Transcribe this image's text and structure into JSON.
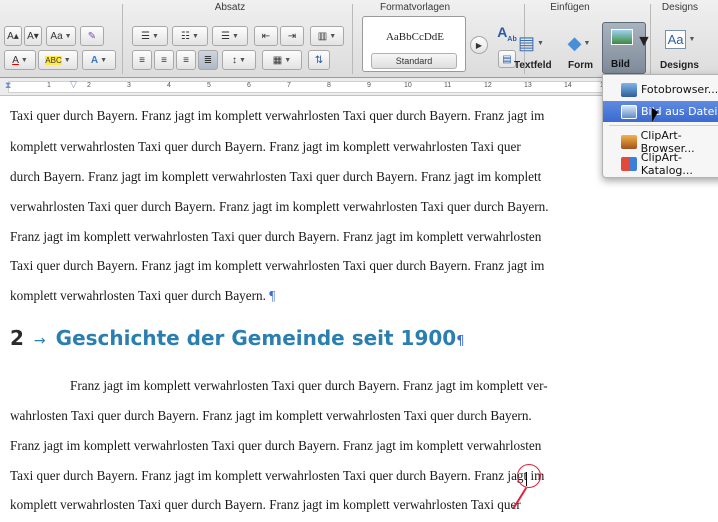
{
  "ribbon": {
    "groups": {
      "absatz": "Absatz",
      "formatvorlagen": "Formatvorlagen",
      "einfuegen": "Einfügen",
      "designs": "Designs"
    },
    "font_buttons": {
      "grow": "A▴",
      "shrink": "A▾",
      "case": "Aa",
      "color_a": "A",
      "highlight": "ABC",
      "effect": "A"
    },
    "style_sample": "AaBbCcDdE",
    "style_name": "Standard",
    "insert": {
      "textfeld": "Textfeld",
      "form": "Form",
      "bild": "Bild"
    },
    "designs_button": "Designs",
    "designs_sample": "Aa"
  },
  "ruler": {
    "ticks": [
      "1",
      "2",
      "3",
      "4",
      "5",
      "6",
      "7",
      "8",
      "9",
      "10",
      "11",
      "12",
      "13",
      "14",
      "15"
    ]
  },
  "menu": {
    "items": [
      {
        "label": "Fotobrowser..."
      },
      {
        "label": "Bild aus Datei..."
      },
      {
        "label": "ClipArt-Browser..."
      },
      {
        "label": "ClipArt-Katalog..."
      }
    ]
  },
  "document": {
    "para1": [
      "Taxi quer durch Bayern. Franz jagt im komplett verwahrlosten Taxi quer durch Bayern. Franz jagt im",
      "komplett verwahrlosten Taxi quer durch Bayern. Franz jagt im komplett verwahrlosten Taxi quer",
      "durch Bayern. Franz jagt im komplett verwahrlosten Taxi quer durch Bayern. Franz jagt im komplett",
      "verwahrlosten Taxi quer durch Bayern. Franz jagt im komplett verwahrlosten Taxi quer durch Bayern.",
      "Franz jagt im komplett verwahrlosten Taxi quer durch Bayern. Franz jagt im komplett verwahrlosten",
      "Taxi quer durch Bayern. Franz jagt im komplett verwahrlosten Taxi quer durch Bayern. Franz jagt im",
      "komplett verwahrlosten Taxi quer durch Bayern."
    ],
    "heading": {
      "number": "2",
      "arrow": "→",
      "text": "Geschichte der Gemeinde seit 1900"
    },
    "para2": [
      "Franz jagt im komplett verwahrlosten Taxi quer durch Bayern. Franz jagt im komplett ver-",
      "wahrlosten Taxi quer durch Bayern. Franz jagt im komplett verwahrlosten Taxi quer durch Bayern.",
      "Franz jagt im komplett verwahrlosten Taxi quer durch Bayern. Franz jagt im komplett verwahrlosten",
      "Taxi quer durch Bayern. Franz jagt im komplett verwahrlosten Taxi quer durch Bayern. Franz jagt im",
      "komplett verwahrlosten Taxi quer durch Bayern. Franz jagt im komplett verwahrlosten Taxi quer"
    ],
    "pilcrow": "¶"
  }
}
